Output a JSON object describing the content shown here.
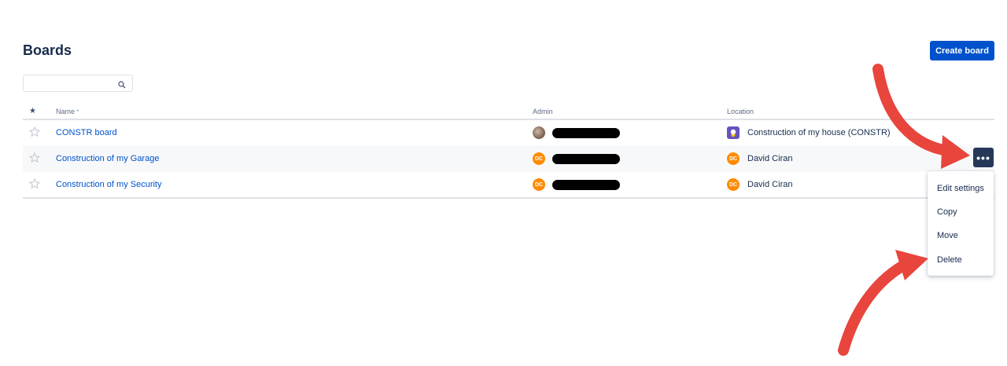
{
  "page": {
    "title": "Boards"
  },
  "toolbar": {
    "create_label": "Create board"
  },
  "search": {
    "value": "",
    "placeholder": ""
  },
  "table": {
    "columns": {
      "star": "★",
      "name": "Name",
      "name_sort": "⌃",
      "admin": "Admin",
      "location": "Location"
    },
    "rows": [
      {
        "name": "CONSTR board",
        "admin_avatar": "",
        "location": "Construction of my house (CONSTR)",
        "location_icon": "project-icon"
      },
      {
        "name": "Construction of my Garage",
        "admin_avatar": "DC",
        "location_avatar": "DC",
        "location": "David Ciran"
      },
      {
        "name": "Construction of my Security",
        "admin_avatar": "DC",
        "location_avatar": "DC",
        "location": "David Ciran"
      }
    ]
  },
  "more_button": {
    "label": "•••"
  },
  "menu": {
    "items": [
      "Edit settings",
      "Copy",
      "Move",
      "Delete"
    ]
  },
  "colors": {
    "primary": "#0052cc",
    "link": "#0052cc",
    "dark_button": "#253858",
    "avatar_orange": "#ff8b00",
    "arrow_red": "#e8453c",
    "project_purple": "#6554c0"
  },
  "icons": [
    "search-icon",
    "star-icon",
    "more-icon",
    "project-icon",
    "arrow-annotation"
  ]
}
